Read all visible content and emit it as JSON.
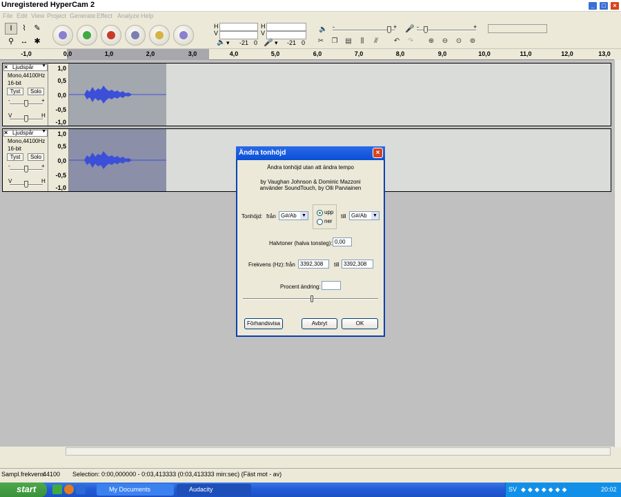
{
  "window": {
    "title": "Unregistered HyperCam 2"
  },
  "menu": [
    "File",
    "Edit",
    "View",
    "Project",
    "Generate",
    "Effect",
    "Analyze",
    "Help"
  ],
  "meters": {
    "h": "H",
    "v": "V",
    "db_left": "-21",
    "zero_left": "0",
    "db_right": "-21",
    "zero_right": "0",
    "plus": "+",
    "minus": "-"
  },
  "ruler": {
    "ticks": [
      "-1,0",
      "0,0",
      "1,0",
      "2,0",
      "3,0",
      "4,0",
      "5,0",
      "6,0",
      "7,0",
      "8,0",
      "9,0",
      "10,0",
      "11,0",
      "12,0",
      "13,0"
    ]
  },
  "tracks": [
    {
      "name": "Ljudspår",
      "rate": "Mono,44100Hz",
      "bits": "16-bit",
      "mute": "Tyst",
      "solo": "Solo",
      "scale": [
        "1,0",
        "0,5",
        "0,0",
        "-0,5",
        "-1,0"
      ],
      "gain_minus": "-",
      "gain_plus": "+",
      "pan_left": "V",
      "pan_right": "H"
    },
    {
      "name": "Ljudspår",
      "rate": "Mono,44100Hz",
      "bits": "16-bit",
      "mute": "Tyst",
      "solo": "Solo",
      "scale": [
        "1,0",
        "0,5",
        "0,0",
        "-0,5",
        "-1,0"
      ],
      "gain_minus": "-",
      "gain_plus": "+",
      "pan_left": "V",
      "pan_right": "H"
    }
  ],
  "dialog": {
    "title": "Ändra tonhöjd",
    "subtitle": "Ändra tonhöjd utan att ändra tempo",
    "credit1": "by Vaughan Johnson & Dominic Mazzoni",
    "credit2": "använder SoundTouch, by Olli Parviainen",
    "pitch_label": "Tonhöjd:",
    "from": "från",
    "to": "till",
    "pitch_from": "G#/Ab",
    "pitch_to": "G#/Ab",
    "up": "upp",
    "down": "ner",
    "semitones_label": "Halvtoner (halva tonsteg):",
    "semitones_value": "0,00",
    "freq_label": "Frekvens (Hz):",
    "freq_from": "3392,308",
    "freq_to": "3392,308",
    "percent_label": "Procent ändring:",
    "percent_value": "",
    "preview": "Förhandsvisa",
    "cancel": "Avbryt",
    "ok": "OK"
  },
  "status": {
    "rate_label": "Sampl.frekvens:",
    "rate_value": "44100",
    "selection": "Selection: 0:00,000000 - 0:03,413333 (0:03,413333 min:sec)  (Fäst mot - av)"
  },
  "taskbar": {
    "start": "start",
    "tasks": [
      "My Documents",
      "Audacity"
    ],
    "lang": "SV",
    "clock": "20:02"
  },
  "colors": {
    "accent": "#2a6ae8",
    "wave": "#3b4fd8",
    "selection": "#a7a7ad"
  }
}
